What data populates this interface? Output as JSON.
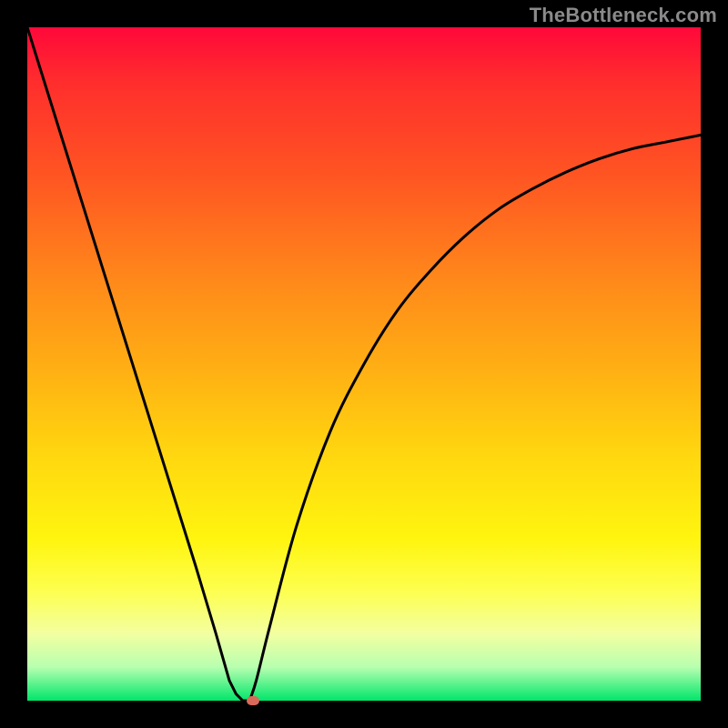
{
  "watermark": "TheBottleneck.com",
  "colors": {
    "frame": "#000000",
    "grad_top": "#ff083a",
    "grad_bottom": "#00e66a",
    "curve": "#000000",
    "marker": "#d96a5a"
  },
  "chart_data": {
    "type": "line",
    "title": "",
    "xlabel": "",
    "ylabel": "",
    "xlim": [
      0,
      100
    ],
    "ylim": [
      0,
      100
    ],
    "legend": false,
    "grid": false,
    "annotations": [],
    "series": [
      {
        "name": "left-branch",
        "x": [
          0,
          5,
          10,
          15,
          20,
          25,
          28,
          30,
          31,
          32
        ],
        "y": [
          100,
          84,
          68,
          52,
          36,
          20,
          10,
          3,
          1,
          0
        ]
      },
      {
        "name": "right-branch",
        "x": [
          33,
          34,
          36,
          40,
          45,
          50,
          55,
          60,
          65,
          70,
          75,
          80,
          85,
          90,
          95,
          100
        ],
        "y": [
          0,
          3,
          11,
          26,
          40,
          50,
          58,
          64,
          69,
          73,
          76,
          78.5,
          80.5,
          82,
          83,
          84
        ]
      },
      {
        "name": "valley-flat",
        "x": [
          32,
          33
        ],
        "y": [
          0,
          0
        ]
      }
    ],
    "marker": {
      "x": 33.5,
      "y": 0
    }
  }
}
